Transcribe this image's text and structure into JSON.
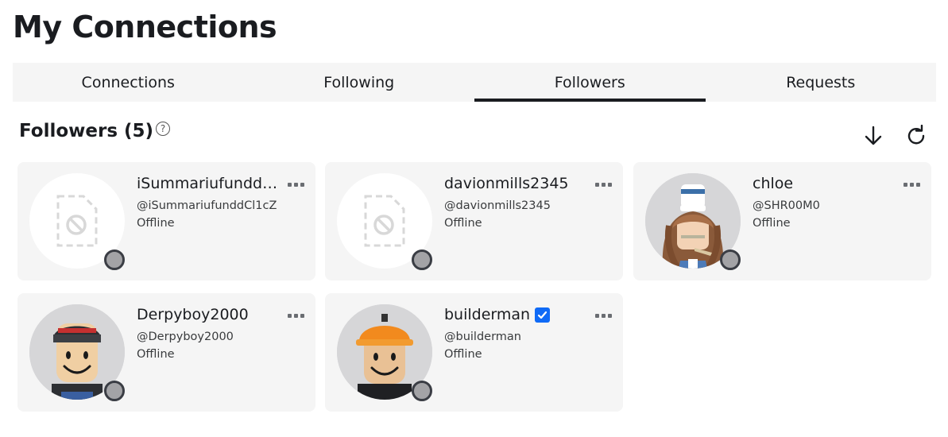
{
  "page": {
    "title": "My Connections"
  },
  "tabs": [
    {
      "label": "Connections",
      "active": false
    },
    {
      "label": "Following",
      "active": false
    },
    {
      "label": "Followers",
      "active": true
    },
    {
      "label": "Requests",
      "active": false
    }
  ],
  "section": {
    "title": "Followers (5)",
    "help_icon": "question-circle-icon"
  },
  "actions": {
    "sort_icon": "arrow-down-icon",
    "refresh_icon": "refresh-icon"
  },
  "colors": {
    "tab_background": "#f5f5f5",
    "card_background": "#f5f5f5",
    "active_tab_underline": "#1a1c20",
    "verified": "#0f6af6",
    "presence_offline": "#a3a3a6"
  },
  "followers": [
    {
      "display_name": "iSummariufunddCl...",
      "username": "@iSummariufunddCl1cZ",
      "status": "Offline",
      "avatar": "blocked-image-placeholder",
      "verified": false
    },
    {
      "display_name": "davionmills2345",
      "username": "@davionmills2345",
      "status": "Offline",
      "avatar": "blocked-image-placeholder",
      "verified": false
    },
    {
      "display_name": "chloe",
      "username": "@SHR00M0",
      "status": "Offline",
      "avatar": "avatar-brown-hair-chef-hat",
      "verified": false
    },
    {
      "display_name": "Derpyboy2000",
      "username": "@Derpyboy2000",
      "status": "Offline",
      "avatar": "avatar-smiley-beanie",
      "verified": false
    },
    {
      "display_name": "builderman",
      "username": "@builderman",
      "status": "Offline",
      "avatar": "avatar-smiley-hardhat",
      "verified": true
    }
  ]
}
